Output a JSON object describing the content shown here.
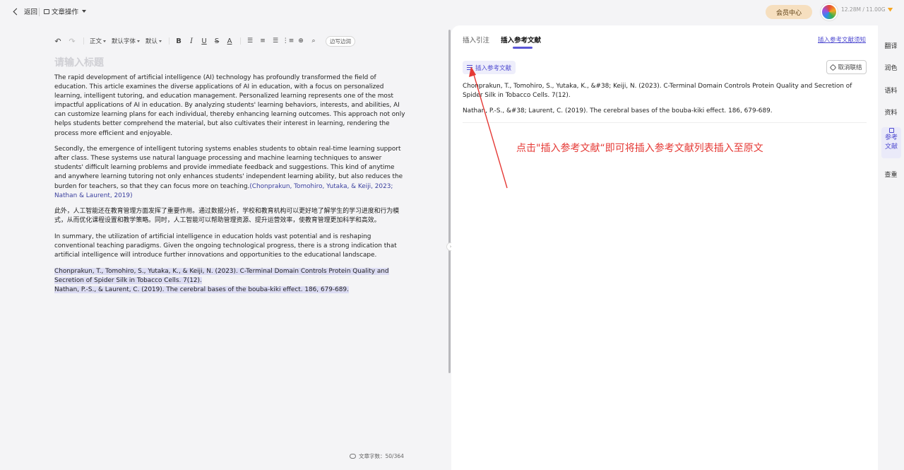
{
  "topbar": {
    "back_label": "返回",
    "doc_ops_label": "文章操作",
    "member_label": "会员中心",
    "storage_text": "12.28M / 11.00G"
  },
  "toolbar": {
    "paragraph_label": "正文",
    "font_label": "默认字体",
    "size_label": "默认",
    "bold": "B",
    "italic": "I",
    "underline": "U",
    "strike": "S",
    "color": "A",
    "polish_label": "边写边润"
  },
  "editor": {
    "title_placeholder": "请输入标题",
    "paragraphs": [
      "The rapid development of artificial intelligence (AI) technology has profoundly transformed the field of education. This article examines the diverse applications of AI in education, with a focus on personalized learning, intelligent tutoring, and education management. Personalized learning represents one of the most impactful applications of AI in education. By analyzing students' learning behaviors, interests, and abilities, AI can customize learning plans for each individual, thereby enhancing learning outcomes. This approach not only helps students better comprehend the material, but also cultivates their interest in learning, rendering the process more efficient and enjoyable.",
      "Secondly, the emergence of intelligent tutoring systems enables students to obtain real-time learning support after class. These systems use natural language processing and machine learning techniques to answer students' difficult learning problems and provide immediate feedback and suggestions. This kind of anytime and anywhere learning tutoring not only enhances students' independent learning ability, but also reduces the burden for teachers, so that they can focus more on teaching.",
      "此外，人工智能还在教育管理方面发挥了重要作用。通过数据分析，学校和教育机构可以更好地了解学生的学习进度和行为模式，从而优化课程设置和教学策略。同时，人工智能可以帮助管理资源、提升运营效率，使教育管理更加科学和高效。",
      "In summary, the utilization of artificial intelligence in education holds vast potential and is reshaping conventional teaching paradigms. Given the ongoing technological progress, there is a strong indication that artificial intelligence will introduce further innovations and opportunities to the educational landscape."
    ],
    "citation": "(Chonprakun, Tomohiro, Yutaka, & Keiji, 2023; Nathan & Laurent, 2019)",
    "references": [
      "Chonprakun, T., Tomohiro, S., Yutaka, K., & Keiji, N. (2023). C-Terminal Domain Controls Protein Quality and Secretion of Spider Silk in Tobacco Cells. 7(12).",
      "Nathan, P.-S., & Laurent, C. (2019). The cerebral bases of the bouba-kiki effect. 186, 679-689."
    ],
    "word_count": "文章字数：50/364"
  },
  "panel": {
    "tabs": [
      "插入引注",
      "插入参考文献"
    ],
    "active_tab": "插入参考文献",
    "notice_link": "插入参考文献须知",
    "insert_button": "插入参考文献",
    "unlink_button": "取消联结",
    "ref_list": [
      "Chonprakun, T., Tomohiro, S., Yutaka, K., &#38; Keiji, N. (2023). C-Terminal Domain Controls Protein Quality and Secretion of Spider Silk in Tobacco Cells. 7(12).",
      "Nathan, P.-S., &#38; Laurent, C. (2019). The cerebral bases of the bouba-kiki effect. 186, 679-689."
    ],
    "annotation": "点击\"插入参考文献“即可将插入参考文献列表插入至原文",
    "annotation_color": "#e53935"
  },
  "rail": {
    "items": [
      "翻译",
      "润色",
      "语料",
      "资料",
      "参考文献",
      "查重"
    ],
    "active": "参考文献"
  },
  "colors": {
    "accent": "#4e4ad0",
    "selection": "#dcdcf3",
    "member_bg": "#f6dfbf"
  }
}
